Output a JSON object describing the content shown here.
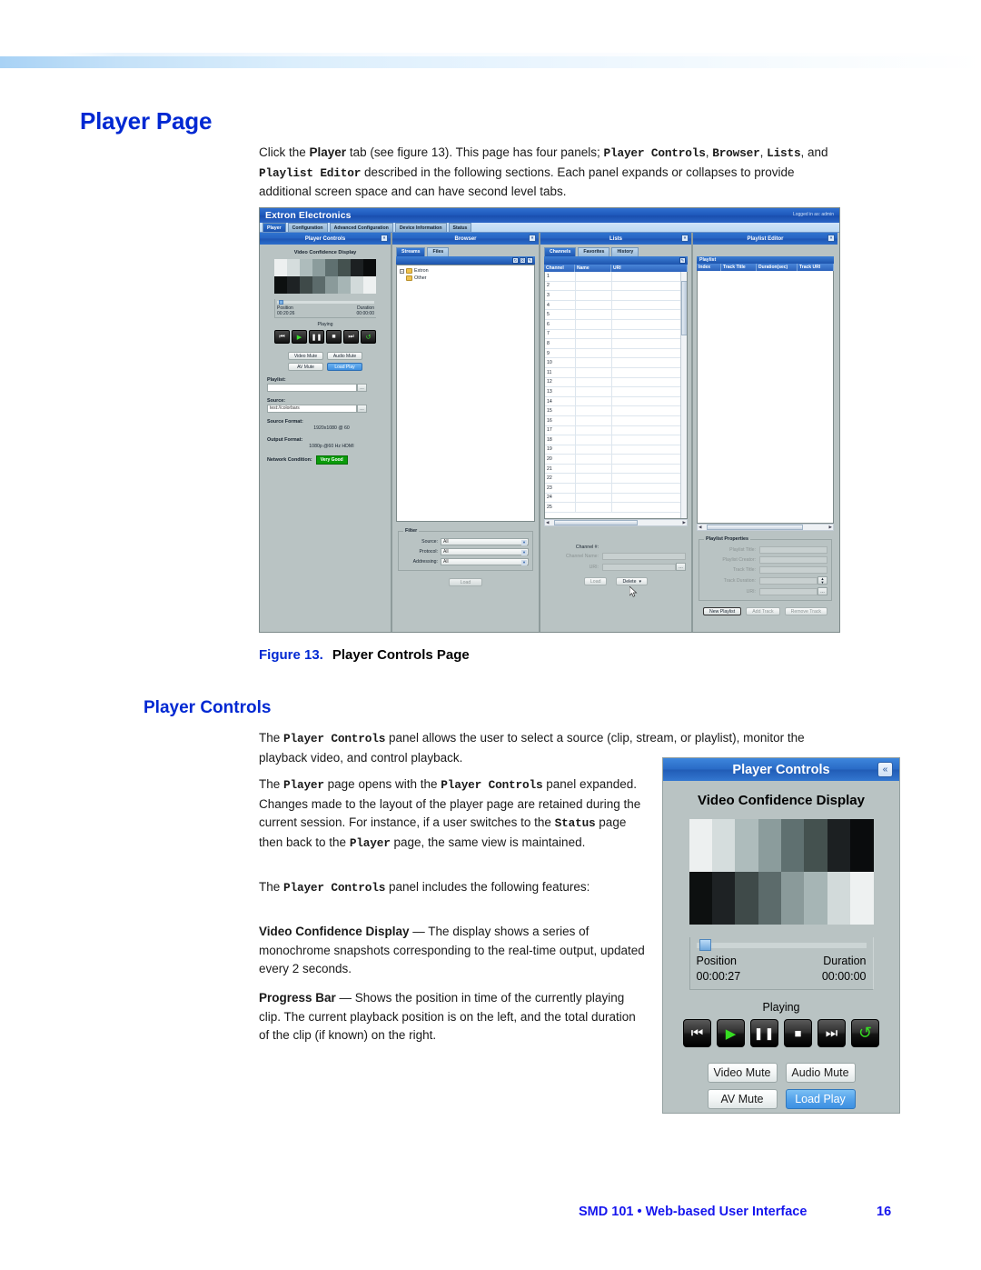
{
  "page": {
    "title": "Player Page",
    "section_title": "Player Controls",
    "intro": {
      "t1": "Click the ",
      "b1": "Player",
      "t2": " tab (see figure 13). This page has four panels; ",
      "m1": "Player Controls",
      "t3": ", ",
      "m2": "Browser",
      "t4": ", ",
      "m3": "Lists",
      "t5": ", and ",
      "m4": "Playlist Editor",
      "t6": " described in the following sections. Each panel expands or collapses to provide additional screen space and can have second level tabs."
    },
    "figure": {
      "number": "Figure 13.",
      "title": "Player Controls Page"
    },
    "pc_para_1": {
      "t1": "The ",
      "m1": "Player Controls",
      "t2": " panel allows the user to select a source (clip, stream, or playlist), monitor the playback video, and control playback."
    },
    "pc_para_2": {
      "t1": "The ",
      "m1": "Player",
      "t2": " page opens with the ",
      "m2": "Player Controls",
      "t3": " panel expanded. Changes made to the layout of the player page are retained during the current session. For instance, if a user switches to the ",
      "m3": "Status",
      "t4": " page then back to the ",
      "m4": "Player",
      "t5": " page, the same view is maintained."
    },
    "pc_para_3": {
      "t1": "The ",
      "m1": "Player Controls",
      "t2": " panel includes the following features:"
    },
    "vcd_para": {
      "b1": "Video Confidence Display",
      "t1": " — The display shows a series of monochrome snapshots corresponding to the real-time output, updated every 2 seconds."
    },
    "pb_para": {
      "b1": "Progress Bar",
      "t1": " — Shows the position in time of the currently playing clip. The current playback position is on the left, and the total duration of the clip (if known) on the right."
    },
    "footer": {
      "text": "SMD 101 • Web-based User Interface",
      "page_number": "16"
    },
    "colors": {
      "heading_blue": "#0028d2",
      "footer_blue": "#1616ee",
      "panel_blue": "#2663c2",
      "accent_button_blue": "#3d90e2",
      "status_green": "#0a9b0a",
      "panel_gray": "#b9c3c3"
    }
  },
  "figure_ui": {
    "brand": "Extron Electronics",
    "login_status": "Logged in as: admin",
    "main_tabs": [
      {
        "label": "Player",
        "active": true
      },
      {
        "label": "Configuration",
        "active": false
      },
      {
        "label": "Advanced Configuration",
        "active": false
      },
      {
        "label": "Device Information",
        "active": false
      },
      {
        "label": "Status",
        "active": false
      }
    ],
    "panels": [
      {
        "name": "Player Controls",
        "collapse_icon": "«"
      },
      {
        "name": "Browser",
        "collapse_icon": "«"
      },
      {
        "name": "Lists",
        "collapse_icon": "«"
      },
      {
        "name": "Playlist Editor",
        "collapse_icon": "«"
      }
    ],
    "player_controls": {
      "vcd_label": "Video Confidence Display",
      "position_label": "Position",
      "duration_label": "Duration",
      "position_value": "00:20:26",
      "duration_value": "00:00:00",
      "state": "Playing",
      "transport": [
        "⏮",
        "▶",
        "⏸",
        "■",
        "⏭",
        "↻"
      ],
      "buttons": {
        "video_mute": "Video Mute",
        "audio_mute": "Audio Mute",
        "av_mute": "AV Mute",
        "load_play": "Load Play"
      },
      "playlist_label": "Playlist:",
      "playlist_value": "",
      "source_label": "Source:",
      "source_value": "test://colorbars",
      "source_format_label": "Source Format:",
      "source_format_value": "1920x1080 @ 60",
      "output_format_label": "Output Format:",
      "output_format_value": "1080p @60 Hz HDMI",
      "network_condition_label": "Network Condition:",
      "network_condition_value": "Very Good",
      "browse_icon": "…"
    },
    "browser": {
      "subtabs": [
        {
          "label": "Streams",
          "active": true
        },
        {
          "label": "Files",
          "active": false
        }
      ],
      "toolbar_icons": [
        "refresh-icon",
        "collapse-icon",
        "add-icon"
      ],
      "tree": [
        {
          "label": "Extron",
          "expandable": true
        },
        {
          "label": "Other",
          "expandable": false
        }
      ],
      "filter_legend": "Filter",
      "filters": [
        {
          "label": "Source:",
          "value": "All"
        },
        {
          "label": "Protocol:",
          "value": "All"
        },
        {
          "label": "Addressing:",
          "value": "All"
        }
      ],
      "load_button": "Load"
    },
    "lists": {
      "subtabs": [
        {
          "label": "Channels",
          "active": true
        },
        {
          "label": "Favorites",
          "active": false
        },
        {
          "label": "History",
          "active": false
        }
      ],
      "columns": [
        "Channel",
        "Name",
        "URI"
      ],
      "rows": [
        "1",
        "2",
        "3",
        "4",
        "5",
        "6",
        "7",
        "8",
        "9",
        "10",
        "11",
        "12",
        "13",
        "14",
        "15",
        "16",
        "17",
        "18",
        "19",
        "20",
        "21",
        "22",
        "23",
        "24",
        "25"
      ],
      "detail_fields": [
        {
          "label": "Channel #:",
          "value": ""
        },
        {
          "label": "Channel Name:",
          "value": ""
        },
        {
          "label": "URI:",
          "value": ""
        }
      ],
      "buttons": {
        "load": "Load",
        "delete": "Delete"
      }
    },
    "playlist_editor": {
      "grid_title": "Playlist",
      "columns": [
        "Index",
        "Track Title",
        "Duration(sec)",
        "Track URI"
      ],
      "properties_legend": "Playlist Properties",
      "properties": [
        {
          "label": "Playlist Title:",
          "value": ""
        },
        {
          "label": "Playlist Creator:",
          "value": ""
        },
        {
          "label": "Track Title:",
          "value": ""
        },
        {
          "label": "Track Duration:",
          "value": ""
        },
        {
          "label": "URI:",
          "value": ""
        }
      ],
      "buttons": {
        "new_playlist": "New Playlist",
        "add_track": "Add Track",
        "remove_track": "Remove Track"
      }
    }
  },
  "player_controls_big": {
    "title": "Player Controls",
    "collapse_icon": "«",
    "vcd_title": "Video Confidence Display",
    "position_label": "Position",
    "duration_label": "Duration",
    "position_value": "00:00:27",
    "duration_value": "00:00:00",
    "state": "Playing",
    "transport": [
      {
        "name": "skip-back-icon",
        "glyph": "⏮",
        "color": "white"
      },
      {
        "name": "play-icon",
        "glyph": "▶",
        "color": "green"
      },
      {
        "name": "pause-icon",
        "glyph": "⏸",
        "color": "white"
      },
      {
        "name": "stop-icon",
        "glyph": "■",
        "color": "white"
      },
      {
        "name": "skip-forward-icon",
        "glyph": "⏭",
        "color": "white"
      },
      {
        "name": "loop-icon",
        "glyph": "↺",
        "color": "green"
      }
    ],
    "buttons": {
      "video_mute": "Video Mute",
      "audio_mute": "Audio Mute",
      "av_mute": "AV Mute",
      "load_play": "Load Play"
    },
    "vcd_top_row": [
      "#edf0f0",
      "#d5dddd",
      "#aebcbc",
      "#8b9c9c",
      "#5f7070",
      "#44514f",
      "#1c2022",
      "#0a0c0d"
    ],
    "vcd_bottom_row": [
      "#0d1010",
      "#1e2224",
      "#3f4a49",
      "#5c6b6b",
      "#8a9a9a",
      "#a6b5b5",
      "#d2dada",
      "#eef1f1"
    ]
  }
}
